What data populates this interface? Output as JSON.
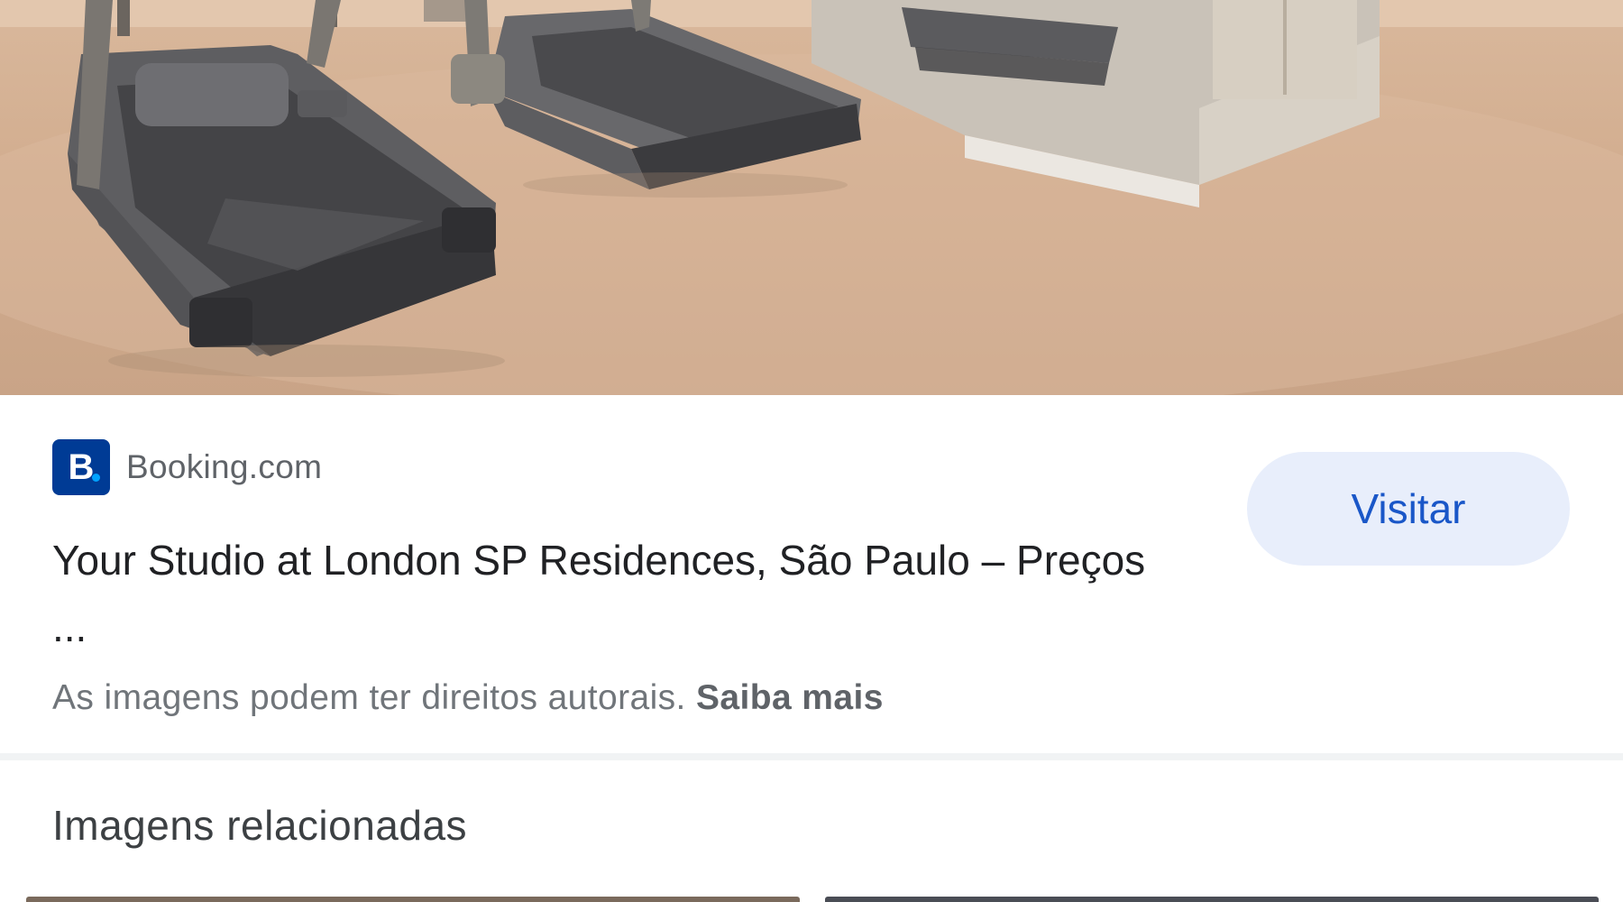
{
  "source": {
    "logo_letter": "B",
    "name": "Booking.com",
    "brand_color": "#003b95"
  },
  "result": {
    "title": "Your Studio at London SP Residences, São Paulo – Preços ..."
  },
  "actions": {
    "visit_label": "Visitar"
  },
  "notice": {
    "text": "As imagens podem ter direitos autorais.",
    "link": "Saiba mais"
  },
  "related": {
    "heading": "Imagens relacionadas"
  },
  "colors": {
    "accent": "#1a57c8",
    "button_bg": "#e8eefb",
    "divider": "#f1f3f4"
  }
}
